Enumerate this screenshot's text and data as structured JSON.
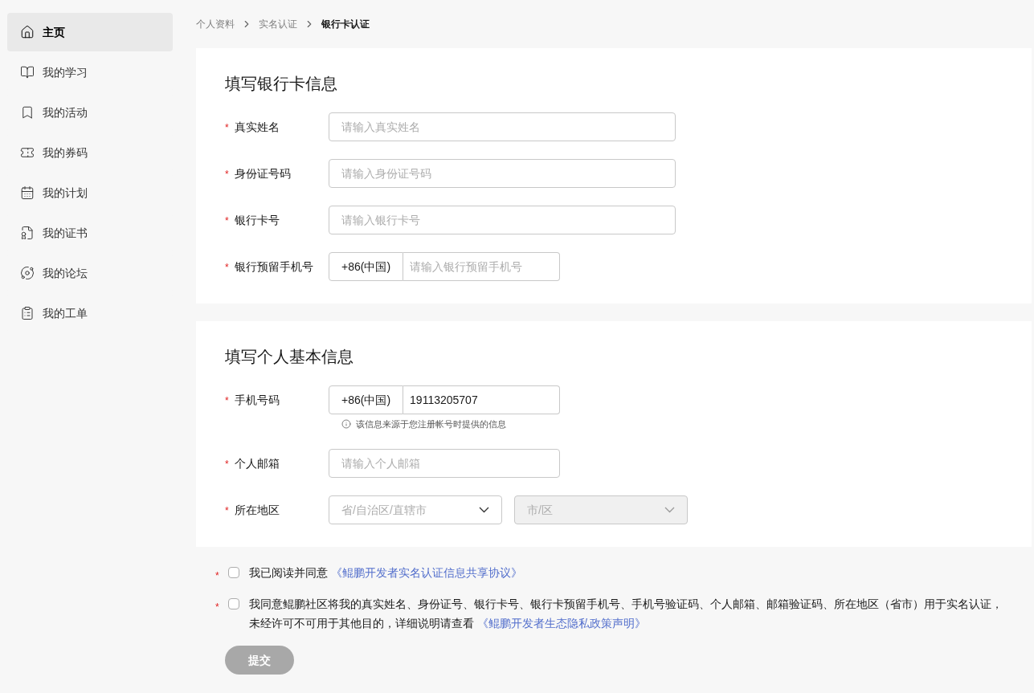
{
  "sidebar": {
    "items": [
      {
        "label": "主页",
        "selected": true
      },
      {
        "label": "我的学习",
        "selected": false
      },
      {
        "label": "我的活动",
        "selected": false
      },
      {
        "label": "我的券码",
        "selected": false
      },
      {
        "label": "我的计划",
        "selected": false
      },
      {
        "label": "我的证书",
        "selected": false
      },
      {
        "label": "我的论坛",
        "selected": false
      },
      {
        "label": "我的工单",
        "selected": false
      }
    ]
  },
  "breadcrumb": [
    {
      "label": "个人资料",
      "current": false
    },
    {
      "label": "实名认证",
      "current": false
    },
    {
      "label": "银行卡认证",
      "current": true
    }
  ],
  "sections": [
    {
      "title": "填写银行卡信息",
      "fields": [
        {
          "kind": "text",
          "mark": "*",
          "label": "真实姓名",
          "placeholder": "请输入真实姓名"
        },
        {
          "kind": "text",
          "mark": "*",
          "label": "身份证号码",
          "placeholder": "请输入身份证号码"
        },
        {
          "kind": "text",
          "mark": "*",
          "label": "银行卡号",
          "placeholder": "请输入银行卡号"
        },
        {
          "kind": "phone",
          "mark": "*",
          "label": "银行预留手机号",
          "prefix": "+86(中国)",
          "placeholder": "请输入银行预留手机号"
        }
      ]
    },
    {
      "title": "填写个人基本信息",
      "fields": [
        {
          "kind": "phone",
          "mark": "*",
          "label": "手机号码",
          "prefix": "+86(中国)",
          "value": "19113205707",
          "hint": "该信息来源于您注册帐号时提供的信息"
        },
        {
          "kind": "email",
          "mark": "*",
          "label": "个人邮箱",
          "placeholder": "请输入个人邮箱"
        },
        {
          "kind": "selects",
          "mark": "*",
          "label": "所在地区",
          "selects": [
            {
              "placeholder": "省/自治区/直辖市",
              "disabled": false
            },
            {
              "placeholder": "市/区",
              "disabled": true
            }
          ]
        }
      ]
    }
  ],
  "agreements": [
    {
      "mark": "*",
      "checked": false,
      "text": "我已阅读并同意",
      "link": "《鲲鹏开发者实名认证信息共享协议》"
    },
    {
      "mark": "*",
      "checked": false,
      "text": "我同意鲲鹏社区将我的真实姓名、身份证号、银行卡号、银行卡预留手机号、手机号验证码、个人邮箱、邮箱验证码、所在地区（省市）用于实名认证，未经许可不可用于其他目的，详细说明请查看",
      "link": "《鲲鹏开发者生态隐私政策声明》"
    }
  ],
  "submit": {
    "label": "提交",
    "disabled": true
  }
}
